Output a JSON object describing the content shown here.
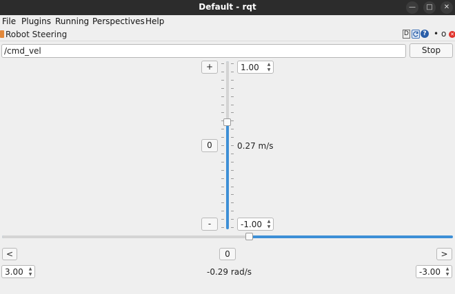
{
  "window": {
    "title": "Default - rqt"
  },
  "menu": [
    "File",
    "Plugins",
    "Running",
    "Perspectives",
    "Help"
  ],
  "plugin": {
    "title": "Robot Steering",
    "header_icons": [
      "D",
      "refresh-icon",
      "help-icon",
      "•",
      "o"
    ]
  },
  "topic": {
    "value": "/cmd_vel",
    "stop_label": "Stop"
  },
  "linear": {
    "plus_label": "+",
    "zero_label": "0",
    "minus_label": "-",
    "max_value": "1.00",
    "min_value": "-1.00",
    "current": "0.27 m/s",
    "slider_value": 0.27
  },
  "angular": {
    "left_label": "<",
    "zero_label": "0",
    "right_label": ">",
    "max_value": "3.00",
    "min_value": "-3.00",
    "current": "-0.29 rad/s",
    "slider_value": -0.29
  },
  "colors": {
    "accent": "#3d8fd6",
    "titlebar": "#2c2c2c",
    "close": "#e0322b"
  }
}
